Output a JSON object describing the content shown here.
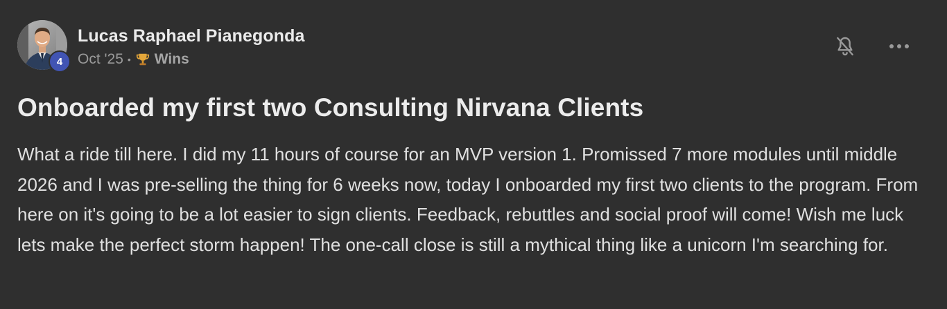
{
  "post": {
    "author": {
      "name": "Lucas Raphael Pianegonda",
      "level": "4"
    },
    "date": "Oct '25",
    "separator": "•",
    "category": "Wins",
    "title": "Onboarded my first two Consulting Nirvana Clients",
    "body": "What a ride till here. I did my 11 hours of course for an MVP version 1. Promissed 7 more modules until middle 2026 and I was pre-selling the thing for 6 weeks now, today I onboarded my first two clients to the program. From here on it's going to be a lot easier to sign clients. Feedback, rebuttles and social proof will come! Wish me luck lets make the perfect storm happen! The one-call close is still a mythical thing like a unicorn I'm searching for."
  },
  "icons": {
    "notifications": "bell-off-icon",
    "more": "more-horizontal-icon",
    "category": "trophy-icon"
  },
  "colors": {
    "background": "#2f2f2f",
    "level_badge": "#4154b3",
    "trophy": "#e5a73a"
  }
}
